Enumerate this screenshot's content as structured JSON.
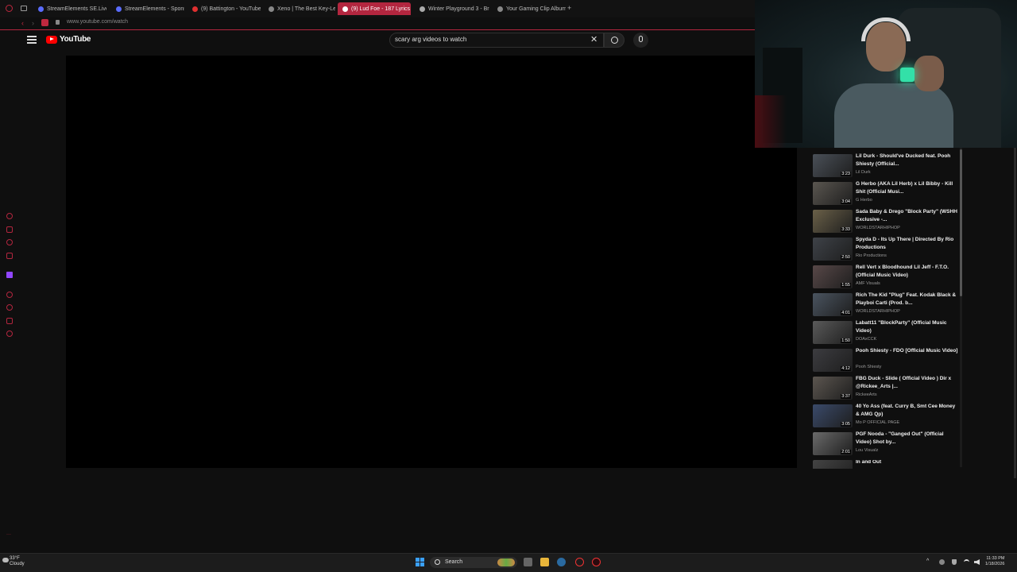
{
  "tabs": [
    {
      "label": "StreamElements SE.Live |",
      "color": "#5a6cff"
    },
    {
      "label": "StreamElements - Sponso",
      "color": "#5a6cff"
    },
    {
      "label": "(9) Battington - YouTube",
      "color": "#e03030"
    },
    {
      "label": "Xeno | The Best Key-Less",
      "color": "#888888"
    },
    {
      "label": "(9) Lud Foe - 187 Lyrics",
      "color": "#ffffff"
    },
    {
      "label": "Winter Playground 3 - Bre",
      "color": "#aaaaaa"
    },
    {
      "label": "Your Gaming Clip Albums",
      "color": "#888888"
    }
  ],
  "new_tab": "+",
  "address": {
    "url": "www.youtube.com/watch"
  },
  "youtube": {
    "logo_text": "YouTube",
    "search_query": "scary arg videos to watch",
    "clear_icon": "✕",
    "search_icon": "⌕",
    "mic_icon": "🎙"
  },
  "accent": "#b3263f",
  "related": [
    {
      "title": "Lil Durk - Should've Ducked feat. Pooh Shiesty (Official...",
      "channel": "Lil Durk",
      "duration": "3:23"
    },
    {
      "title": "G Herbo (AKA Lil Herb) x Lil Bibby - Kill Shit (Official Musi...",
      "channel": "G Herbo",
      "duration": "3:04"
    },
    {
      "title": "Sada Baby & Drego \"Block Party\" (WSHH Exclusive -...",
      "channel": "WORLDSTARHIPHOP",
      "duration": "3:33"
    },
    {
      "title": "Spyda D - Its Up There | Directed By Rio Productions",
      "channel": "Rio Productions",
      "duration": "2:50"
    },
    {
      "title": "Rell Vert x Bloodhound Lil Jeff - F.T.O. (Official Music Video)",
      "channel": "AMF Visuals",
      "duration": "1:55"
    },
    {
      "title": "Rich The Kid \"Plug\" Feat. Kodak Black & Playboi Carti (Prod. b...",
      "channel": "WORLDSTARHIPHOP",
      "duration": "4:01"
    },
    {
      "title": "Labatt11 \"BlockParty\" (Official Music Video)",
      "channel": "DOAxCCK",
      "duration": "1:50"
    },
    {
      "title": "Pooh Shiesty - FDO [Official Music Video]",
      "channel": "Pooh Shiesty",
      "duration": "4:12"
    },
    {
      "title": "FBG Duck - Slide ( Official Video ) Dir x @Rickee_Arts |...",
      "channel": "RickeeArts",
      "duration": "3:37"
    },
    {
      "title": "40 Yo Ass (feat. Curry B, Smt Cee Money & AMG Qp)",
      "channel": "Mo P OFFICIAL PAGE",
      "duration": "3:05"
    },
    {
      "title": "PGF Nooda - \"Ganged Out\" (Official Video) Shot by...",
      "channel": "Lou Visualz",
      "duration": "2:01"
    },
    {
      "title": "In and Out",
      "channel": "",
      "duration": ""
    }
  ],
  "taskbar": {
    "weather_temp": "33°F",
    "weather_desc": "Cloudy",
    "search_label": "Search",
    "time": "11:33 PM",
    "date": "1/18/2026"
  }
}
